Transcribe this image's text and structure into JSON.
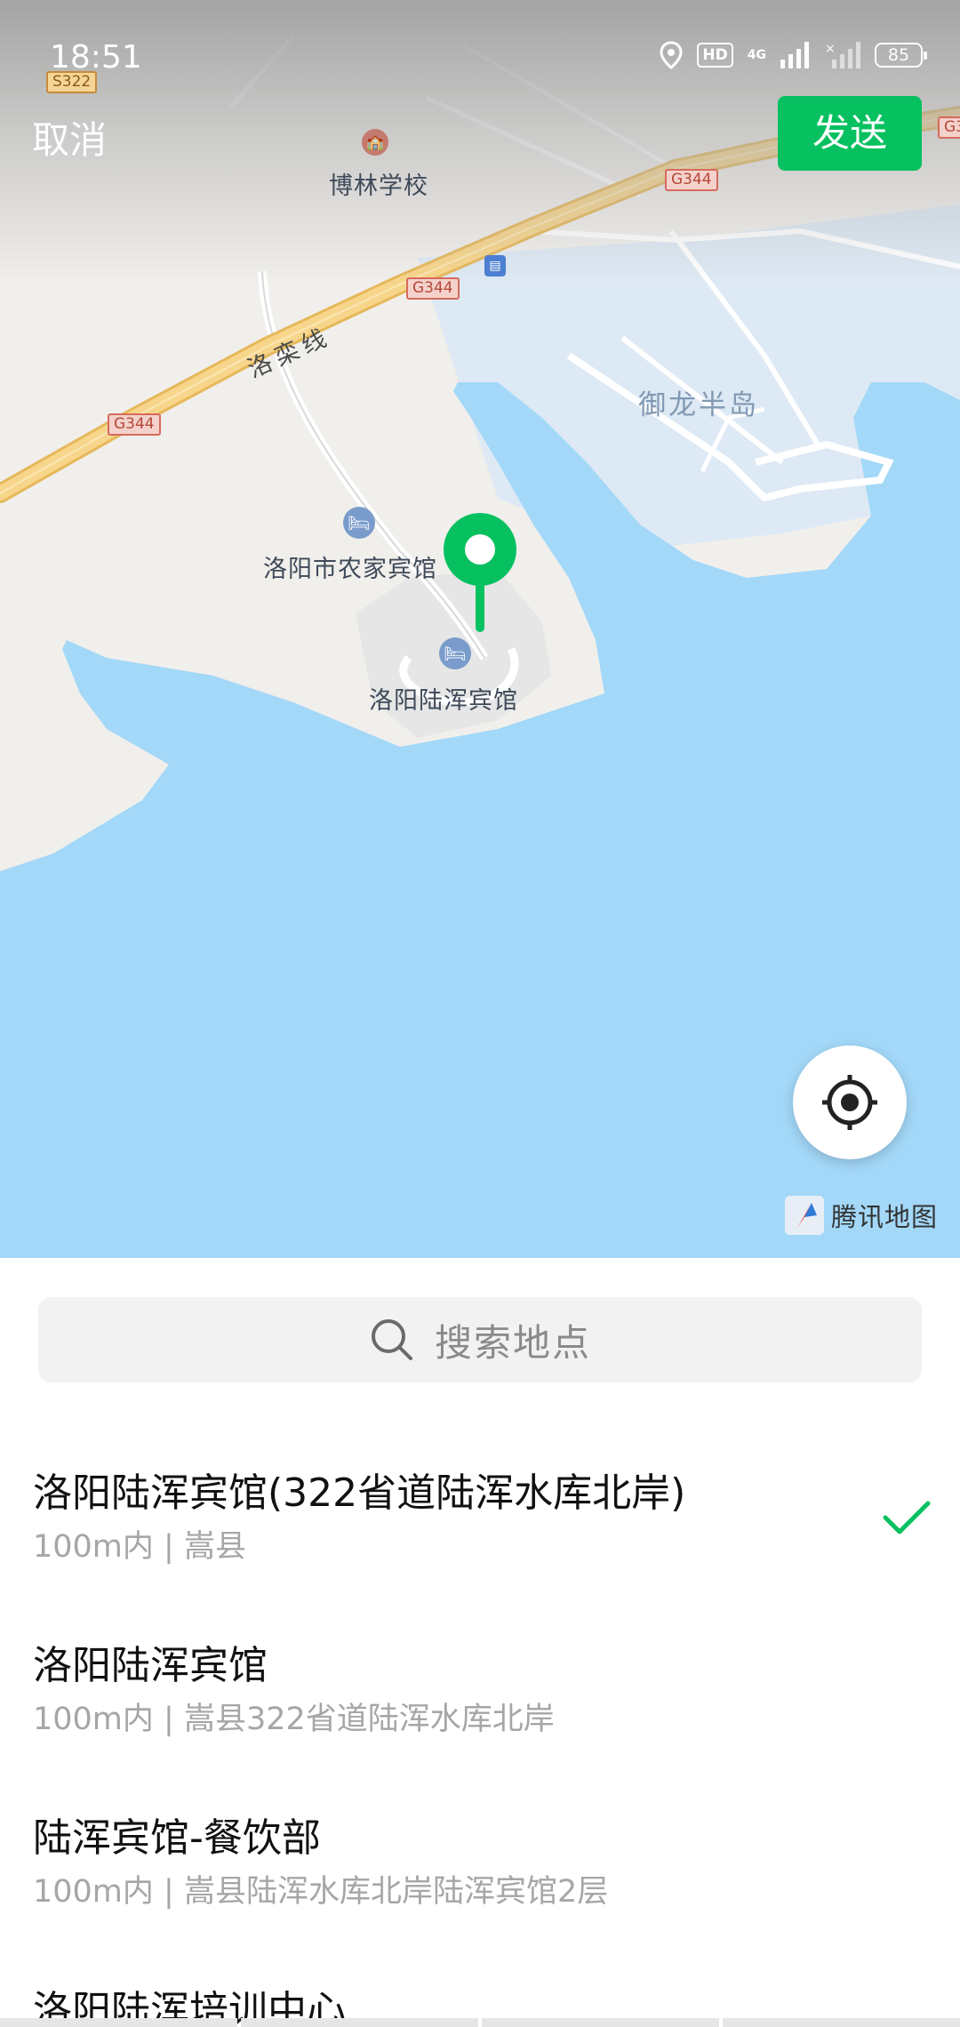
{
  "status_bar": {
    "time": "18:51",
    "hd_badge": "HD",
    "network": "4G",
    "battery": "85"
  },
  "header": {
    "cancel_label": "取消",
    "send_label": "发送",
    "send_color": "#07c160"
  },
  "map": {
    "road_shields": [
      "S322",
      "G344",
      "G344",
      "G344",
      "G3"
    ],
    "road_name": "洛栾线",
    "pois": {
      "school": "博林学校",
      "farm_hotel": "洛阳市农家宾馆",
      "lucun_hotel": "洛阳陆浑宾馆",
      "peninsula": "御龙半岛"
    },
    "attribution": "腾讯地图",
    "water_color": "#a3d8f8",
    "land_color": "#f1efec"
  },
  "search": {
    "placeholder": "搜索地点"
  },
  "places": [
    {
      "name": "洛阳陆浑宾馆(322省道陆浑水库北岸)",
      "detail": "100m内 | 嵩县",
      "selected": true
    },
    {
      "name": "洛阳陆浑宾馆",
      "detail": "100m内 | 嵩县322省道陆浑水库北岸",
      "selected": false
    },
    {
      "name": "陆浑宾馆-餐饮部",
      "detail": "100m内 | 嵩县陆浑水库北岸陆浑宾馆2层",
      "selected": false
    },
    {
      "name": "洛阳陆浑培训中心",
      "detail": "",
      "selected": false
    }
  ]
}
